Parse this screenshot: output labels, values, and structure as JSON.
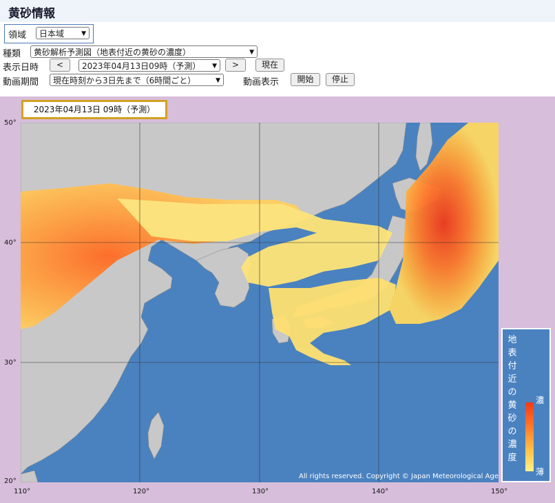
{
  "header": {
    "title": "黄砂情報"
  },
  "controls": {
    "region_label": "領域",
    "region_value": "日本域",
    "type_label": "種類",
    "type_value": "黄砂解析予測図（地表付近の黄砂の濃度）",
    "datetime_label": "表示日時",
    "prev_button": "<",
    "datetime_value": "2023年04月13日09時（予測）",
    "next_button": ">",
    "now_button": "現在",
    "period_label": "動画期間",
    "period_value": "現在時刻から3日先まで（6時間ごと）",
    "animation_label": "動画表示",
    "start_button": "開始",
    "stop_button": "停止"
  },
  "map": {
    "date_label": "2023年04月13日  09時（予測）",
    "lat_ticks": [
      "50°",
      "40°",
      "30°",
      "20°"
    ],
    "lon_ticks": [
      "110°",
      "120°",
      "130°",
      "140°",
      "150°"
    ],
    "copyright": "All rights reserved. Copyright © Japan Meteorological Agency",
    "colors": {
      "sea": "#4a82c0",
      "land": "#c8c8c8",
      "low": "#fff28a",
      "high": "#f03a1a",
      "frame": "#d7bedb",
      "date_frame": "#d4a020"
    }
  },
  "legend": {
    "title": "地表付近の黄砂の濃度",
    "high": "濃",
    "low": "薄"
  }
}
